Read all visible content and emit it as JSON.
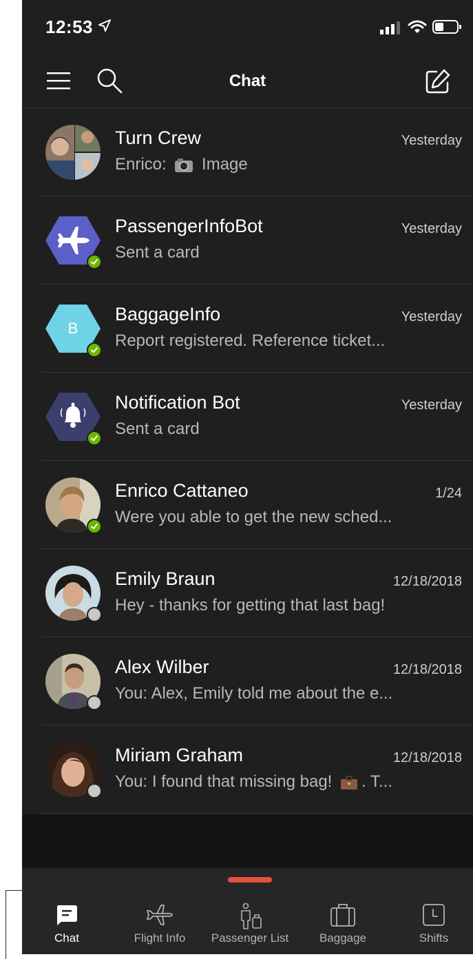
{
  "status_bar": {
    "time": "12:53",
    "location_icon": "location-arrow-icon",
    "signal_icon": "cellular-signal-icon",
    "wifi_icon": "wifi-icon",
    "battery_icon": "battery-icon"
  },
  "header": {
    "title": "Chat",
    "menu_icon": "hamburger-menu-icon",
    "search_icon": "search-icon",
    "compose_icon": "compose-icon"
  },
  "chats": [
    {
      "name": "Turn Crew",
      "time": "Yesterday",
      "preview_sender": "Enrico:",
      "preview_text": "Image",
      "avatar": "group-photo",
      "presence": "none"
    },
    {
      "name": "PassengerInfoBot",
      "time": "Yesterday",
      "preview": "Sent a card",
      "avatar": "airplane-icon",
      "avatar_color": "#5b5fc7",
      "presence": "available"
    },
    {
      "name": "BaggageInfo",
      "time": "Yesterday",
      "preview": "Report registered. Reference ticket...",
      "avatar_letter": "B",
      "avatar_color": "#6ed3e6",
      "presence": "available"
    },
    {
      "name": "Notification Bot",
      "time": "Yesterday",
      "preview": "Sent a card",
      "avatar": "bell-icon",
      "avatar_color": "#3b3f6e",
      "presence": "available"
    },
    {
      "name": "Enrico Cattaneo",
      "time": "1/24",
      "preview": "Were you able to get the new sched...",
      "avatar": "person-photo",
      "presence": "available"
    },
    {
      "name": "Emily Braun",
      "time": "12/18/2018",
      "preview": "Hey - thanks for getting that last bag!",
      "avatar": "person-photo",
      "presence": "offline"
    },
    {
      "name": "Alex Wilber",
      "time": "12/18/2018",
      "preview": "You: Alex, Emily told me about the e...",
      "avatar": "person-photo",
      "presence": "offline"
    },
    {
      "name": "Miriam Graham",
      "time": "12/18/2018",
      "preview_before": "You: I found that missing bag!",
      "preview_after": ". T...",
      "avatar": "person-photo",
      "presence": "offline"
    }
  ],
  "tabs": [
    {
      "label": "Chat",
      "icon": "chat-icon",
      "active": true
    },
    {
      "label": "Flight Info",
      "icon": "airplane-icon",
      "active": false
    },
    {
      "label": "Passenger List",
      "icon": "passenger-icon",
      "active": false
    },
    {
      "label": "Baggage",
      "icon": "baggage-icon",
      "active": false
    },
    {
      "label": "Shifts",
      "icon": "shifts-icon",
      "active": false
    }
  ],
  "colors": {
    "background": "#1f1f1f",
    "available": "#6bb700",
    "offline": "#c8c8c8",
    "accent": "#e2523f"
  }
}
